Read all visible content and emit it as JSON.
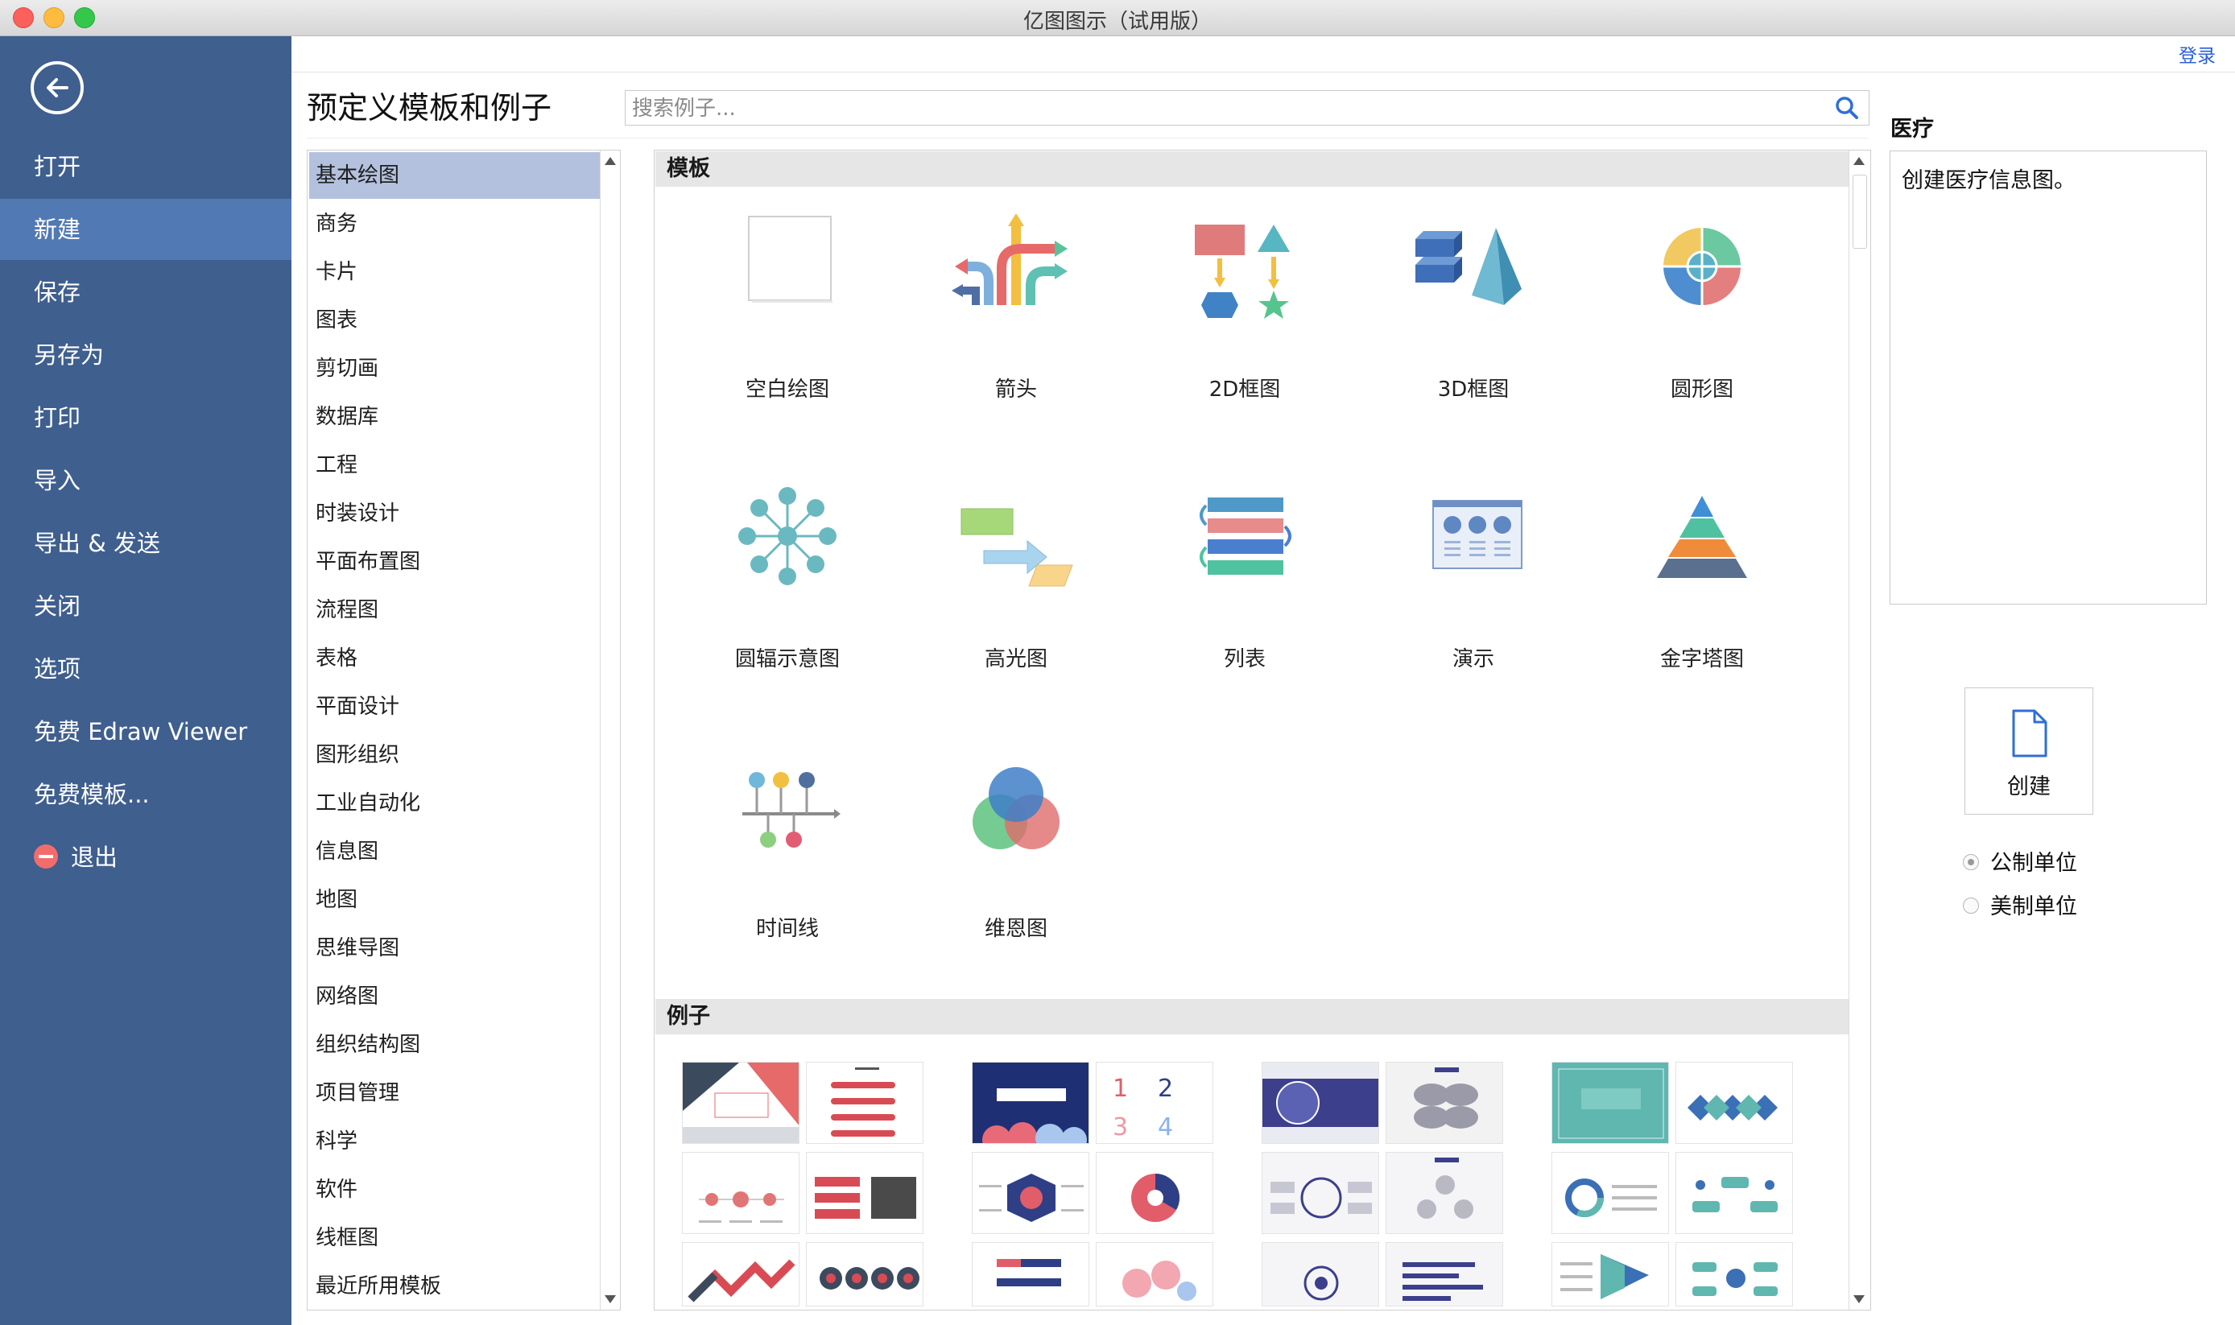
{
  "window": {
    "title": "亿图图示（试用版）"
  },
  "header": {
    "login_label": "登录",
    "heading": "预定义模板和例子",
    "search_placeholder": "搜索例子..."
  },
  "sidebar": {
    "items": [
      {
        "label": "打开",
        "active": false
      },
      {
        "label": "新建",
        "active": true
      },
      {
        "label": "保存",
        "active": false
      },
      {
        "label": "另存为",
        "active": false
      },
      {
        "label": "打印",
        "active": false
      },
      {
        "label": "导入",
        "active": false
      },
      {
        "label": "导出 & 发送",
        "active": false
      },
      {
        "label": "关闭",
        "active": false
      },
      {
        "label": "选项",
        "active": false
      },
      {
        "label": "免费 Edraw Viewer",
        "active": false
      },
      {
        "label": "免费模板...",
        "active": false
      },
      {
        "label": "退出",
        "active": false
      }
    ]
  },
  "categories": [
    "基本绘图",
    "商务",
    "卡片",
    "图表",
    "剪切画",
    "数据库",
    "工程",
    "时装设计",
    "平面布置图",
    "流程图",
    "表格",
    "平面设计",
    "图形组织",
    "工业自动化",
    "信息图",
    "地图",
    "思维导图",
    "网络图",
    "组织结构图",
    "项目管理",
    "科学",
    "软件",
    "线框图",
    "最近所用模板"
  ],
  "selected_category": "基本绘图",
  "templates_section": {
    "label": "模板"
  },
  "examples_section": {
    "label": "例子"
  },
  "templates": [
    {
      "label": "空白绘图",
      "icon": "blank-page-icon"
    },
    {
      "label": "箭头",
      "icon": "arrows-icon"
    },
    {
      "label": "2D框图",
      "icon": "2d-block-icon"
    },
    {
      "label": "3D框图",
      "icon": "3d-block-icon"
    },
    {
      "label": "圆形图",
      "icon": "circle-diagram-icon"
    },
    {
      "label": "圆辐示意图",
      "icon": "radial-diagram-icon"
    },
    {
      "label": "高光图",
      "icon": "highlight-diagram-icon"
    },
    {
      "label": "列表",
      "icon": "list-icon"
    },
    {
      "label": "演示",
      "icon": "presentation-icon"
    },
    {
      "label": "金字塔图",
      "icon": "pyramid-icon"
    },
    {
      "label": "时间线",
      "icon": "timeline-icon"
    },
    {
      "label": "维恩图",
      "icon": "venn-icon"
    }
  ],
  "detail": {
    "title": "医疗",
    "description": "创建医疗信息图。",
    "create_label": "创建",
    "units": [
      {
        "label": "公制单位",
        "checked": true
      },
      {
        "label": "美制单位",
        "checked": false
      }
    ]
  },
  "colors": {
    "sidebar_bg": "#3f5f8e",
    "sidebar_active": "#5179b3",
    "selection": "#b3c1de",
    "link": "#2a5fd8"
  }
}
